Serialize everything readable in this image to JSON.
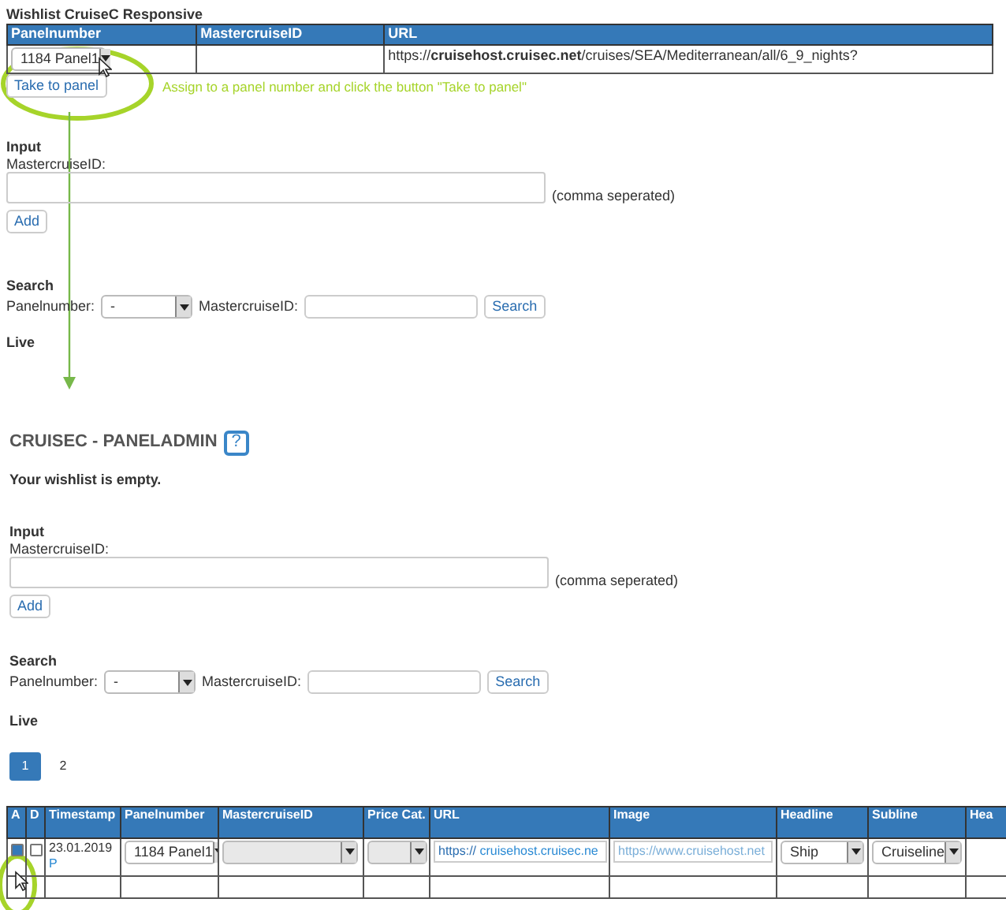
{
  "wishlist": {
    "title": "Wishlist CruiseC Responsive",
    "table": {
      "columns": [
        "Panelnumber",
        "MastercruiseID",
        "URL"
      ],
      "rows": [
        {
          "panelnumber": "1184 Panel1",
          "url": "https://**cruisehost.cruisec.net**/cruises/SEA/Mediterranean/all/6_9_nights?"
        }
      ]
    },
    "take_button": "Take to panel",
    "input": {
      "heading": "Input",
      "label": "MastercruiseID:",
      "hint": "(comma seperated)",
      "button": "Add"
    },
    "search": {
      "heading": "Search",
      "panel_label": "Panelnumber:",
      "panel_value": "-",
      "id_label": "MastercruiseID:",
      "button": "Search"
    },
    "live": "Live"
  },
  "annotation": {
    "text": "Assign to a panel number and click the button \"Take to panel\""
  },
  "admin": {
    "title": "CRUISEC - PANELADMIN",
    "help": "?",
    "empty_message": "Your wishlist is empty.",
    "input": {
      "heading": "Input",
      "label": "MastercruiseID:",
      "hint": "(comma seperated)",
      "button": "Add"
    },
    "search": {
      "heading": "Search",
      "panel_label": "Panelnumber:",
      "panel_value": "-",
      "id_label": "MastercruiseID:",
      "button": "Search"
    },
    "live": "Live",
    "pagination": [
      {
        "label": "1",
        "selected": true
      },
      {
        "label": "2",
        "selected": false
      }
    ],
    "table": {
      "columns": [
        "A",
        "D",
        "Timestamp",
        "Panelnumber",
        "MastercruiseID",
        "Price Cat.",
        "URL",
        "Image",
        "Headline",
        "Subline",
        "Hea"
      ],
      "rows": [
        {
          "a_checked": true,
          "d_checked": false,
          "timestamp": "23.01.2019",
          "link": "P",
          "panelnumber": "1184 Panel1",
          "url_scheme": "https://",
          "url_link": "cruisehost.cruisec.ne",
          "image": "https://www.cruisehost.net",
          "headline": "Ship",
          "subline": "Cruiseline"
        }
      ]
    }
  }
}
